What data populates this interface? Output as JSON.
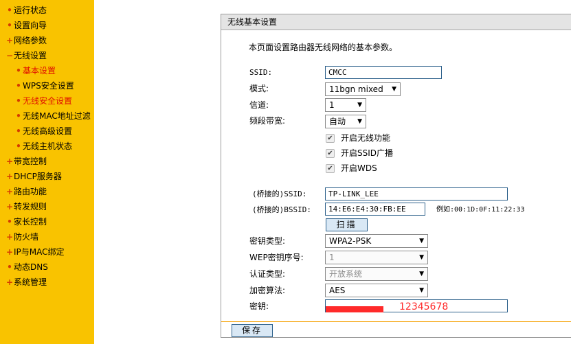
{
  "sidebar": {
    "items": [
      {
        "mark": "•",
        "label": "运行状态"
      },
      {
        "mark": "•",
        "label": "设置向导"
      },
      {
        "mark": "+",
        "label": "网络参数"
      },
      {
        "mark": "−",
        "label": "无线设置"
      },
      {
        "mark": "•",
        "label": "基本设置"
      },
      {
        "mark": "•",
        "label": "WPS安全设置"
      },
      {
        "mark": "•",
        "label": "无线安全设置"
      },
      {
        "mark": "•",
        "label": "无线MAC地址过滤"
      },
      {
        "mark": "•",
        "label": "无线高级设置"
      },
      {
        "mark": "•",
        "label": "无线主机状态"
      },
      {
        "mark": "+",
        "label": "带宽控制"
      },
      {
        "mark": "+",
        "label": "DHCP服务器"
      },
      {
        "mark": "+",
        "label": "路由功能"
      },
      {
        "mark": "+",
        "label": "转发规则"
      },
      {
        "mark": "•",
        "label": "家长控制"
      },
      {
        "mark": "+",
        "label": "防火墙"
      },
      {
        "mark": "+",
        "label": "IP与MAC绑定"
      },
      {
        "mark": "•",
        "label": "动态DNS"
      },
      {
        "mark": "+",
        "label": "系统管理"
      }
    ]
  },
  "panel": {
    "title": "无线基本设置",
    "intro": "本页面设置路由器无线网络的基本参数。"
  },
  "form": {
    "ssid_label": "SSID:",
    "ssid_value": "CMCC",
    "mode_label": "模式:",
    "mode_value": "11bgn mixed",
    "channel_label": "信道:",
    "channel_value": "1",
    "bandwidth_label": "频段带宽:",
    "bandwidth_value": "自动",
    "enable_wireless_label": "开启无线功能",
    "enable_ssid_broadcast_label": "开启SSID广播",
    "enable_wds_label": "开启WDS",
    "bridge_ssid_label": "(桥接的)SSID:",
    "bridge_ssid_value": "TP-LINK_LEE",
    "bridge_bssid_label": "(桥接的)BSSID:",
    "bridge_bssid_value": "14:E6:E4:30:FB:EE",
    "bssid_example": "例如:00:1D:0F:11:22:33",
    "scan_label": "扫描",
    "key_type_label": "密钥类型:",
    "key_type_value": "WPA2-PSK",
    "wep_index_label": "WEP密钥序号:",
    "wep_index_value": "1",
    "auth_type_label": "认证类型:",
    "auth_type_value": "开放系统",
    "encryption_label": "加密算法:",
    "encryption_value": "AES",
    "key_label": "密钥:",
    "key_overlay_text": "12345678",
    "save_label": "保存"
  },
  "colors": {
    "sidebar_bg": "#f9c300",
    "active_text": "#e01000",
    "redaction": "#ff2a2a"
  }
}
